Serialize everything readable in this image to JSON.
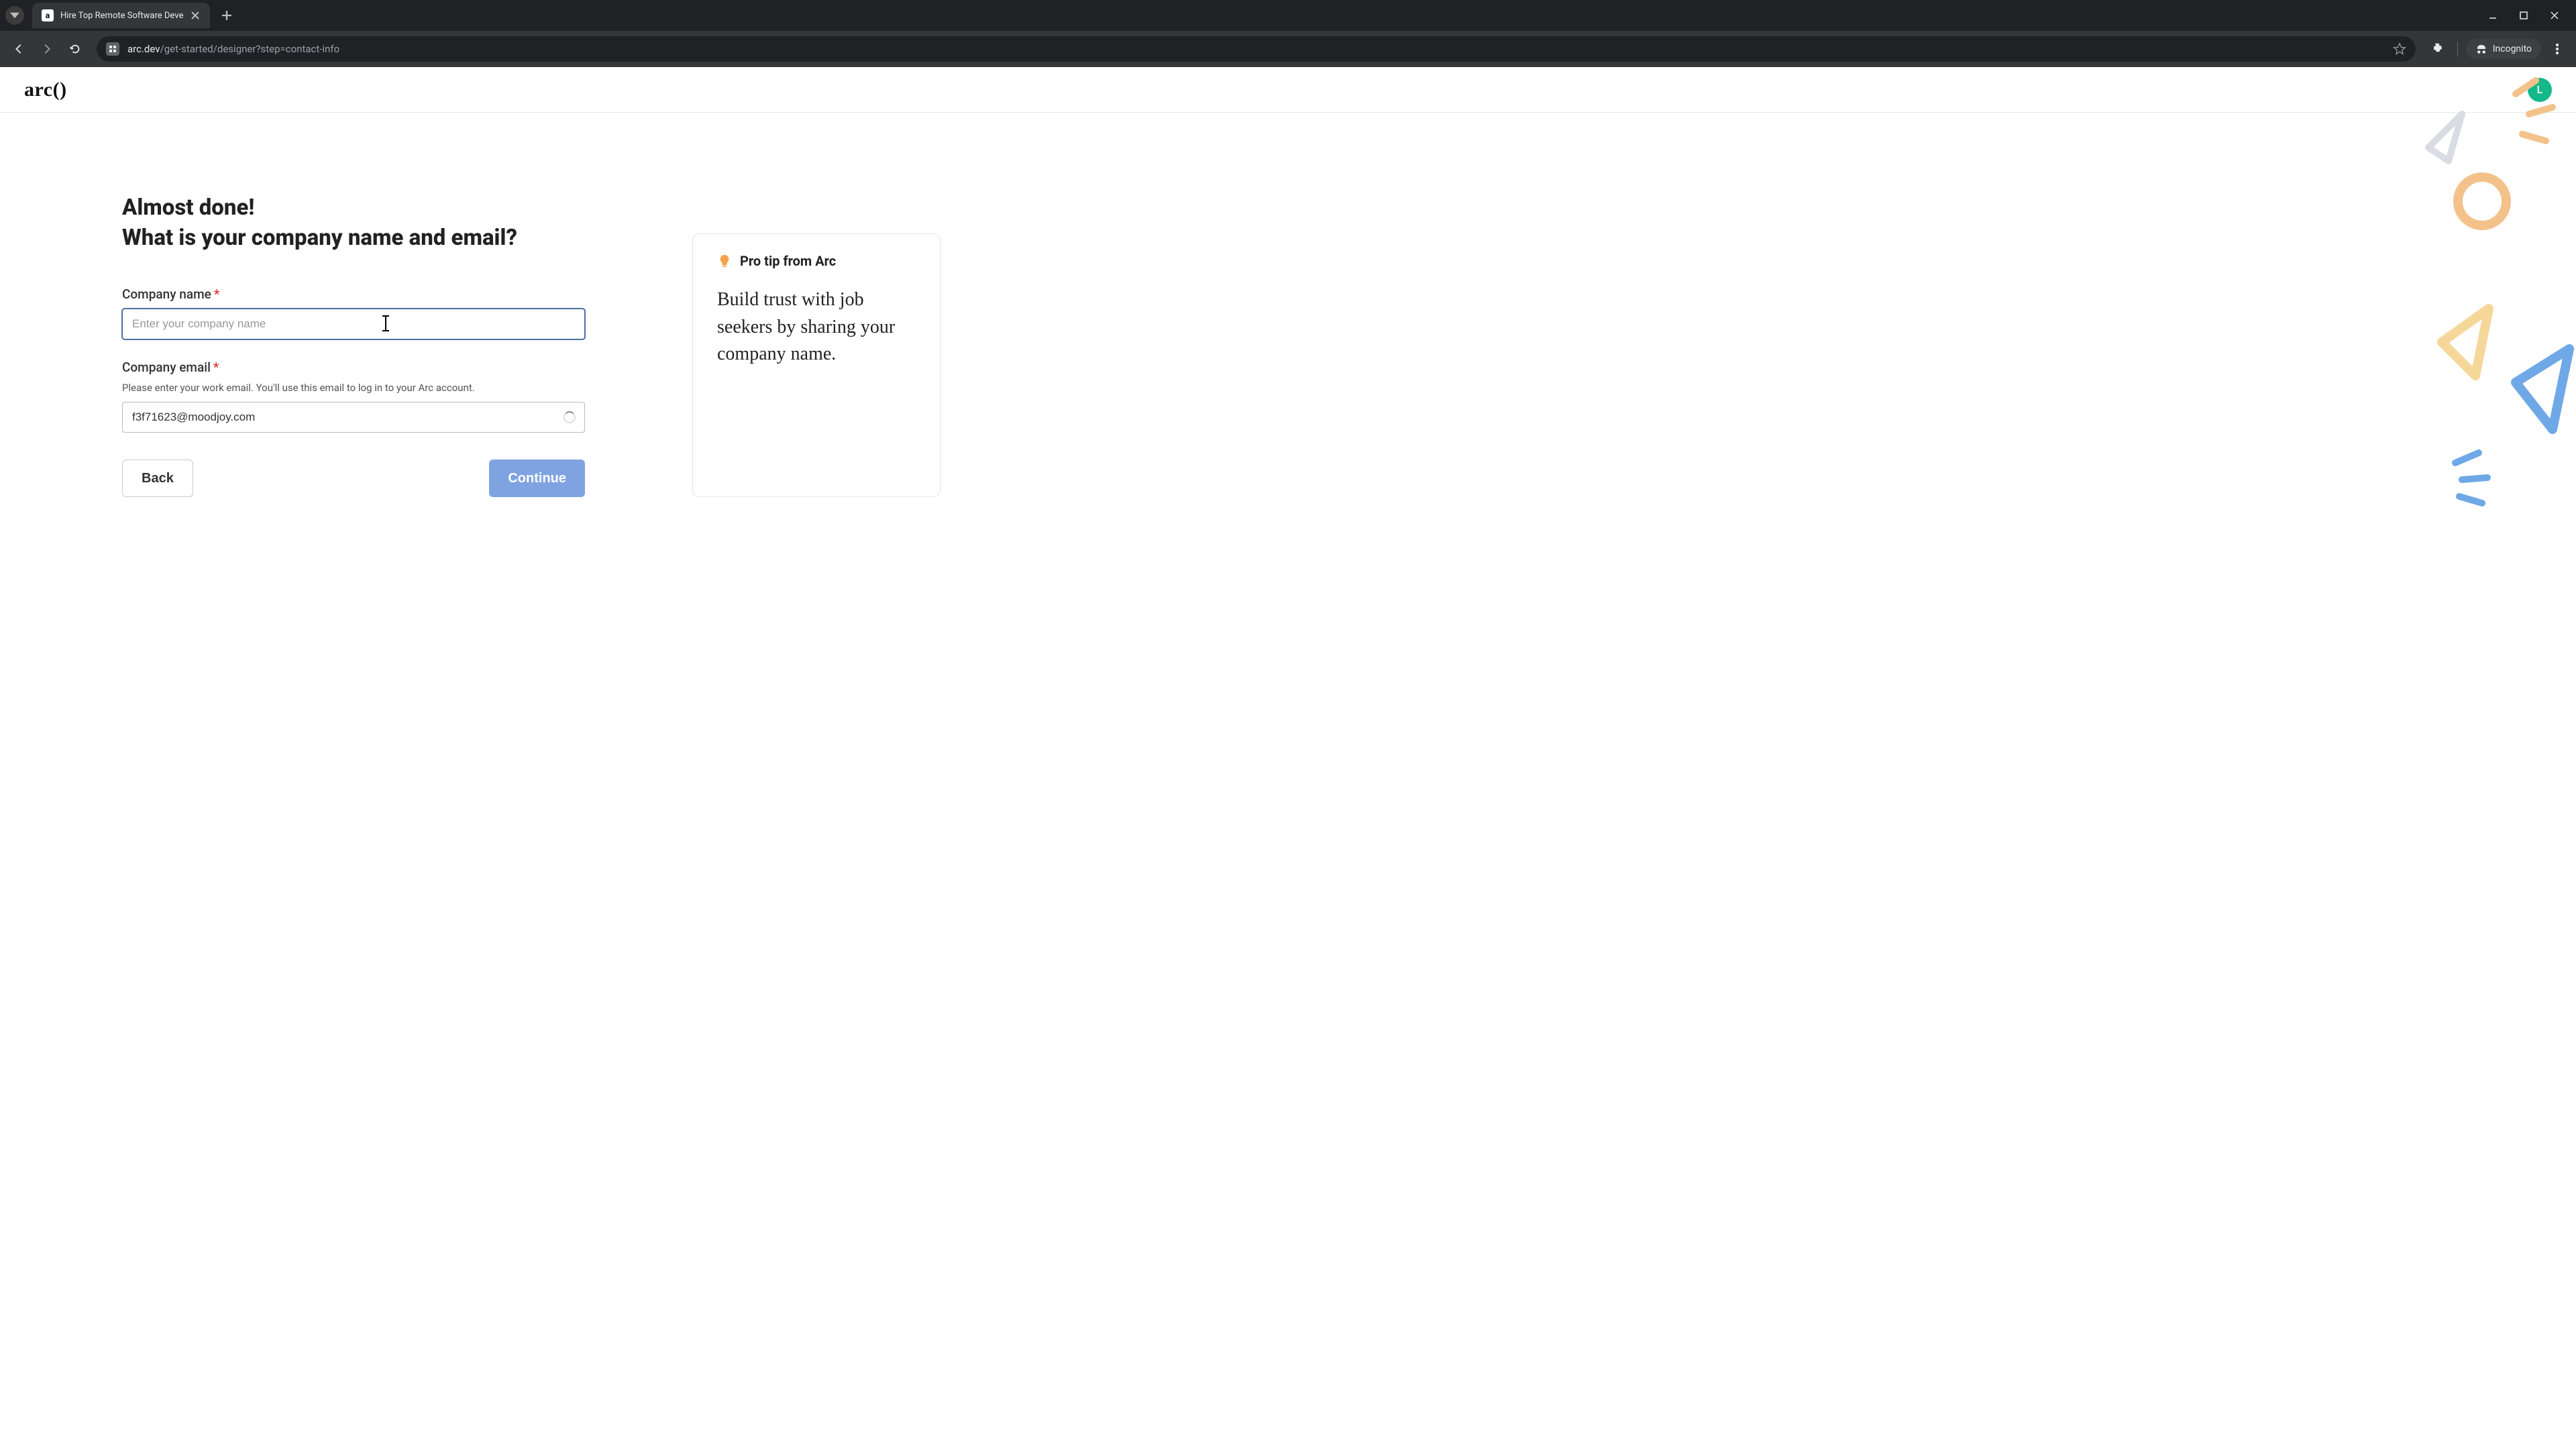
{
  "browser": {
    "tab_title": "Hire Top Remote Software Deve",
    "url_host": "arc.dev",
    "url_path": "/get-started/designer?step=contact-info",
    "incognito_label": "Incognito"
  },
  "header": {
    "logo_text": "arc()",
    "avatar_initial": "L"
  },
  "form": {
    "heading_line1": "Almost done!",
    "heading_line2": "What is your company name and email?",
    "company_name": {
      "label": "Company name",
      "required_marker": "*",
      "placeholder": "Enter your company name",
      "value": ""
    },
    "company_email": {
      "label": "Company email",
      "required_marker": "*",
      "help": "Please enter your work email. You'll use this email to log in to your Arc account.",
      "value": "f3f71623@moodjoy.com"
    },
    "back_button": "Back",
    "continue_button": "Continue"
  },
  "tip": {
    "title": "Pro tip from Arc",
    "body": "Build trust with job seekers by sharing your company name."
  }
}
